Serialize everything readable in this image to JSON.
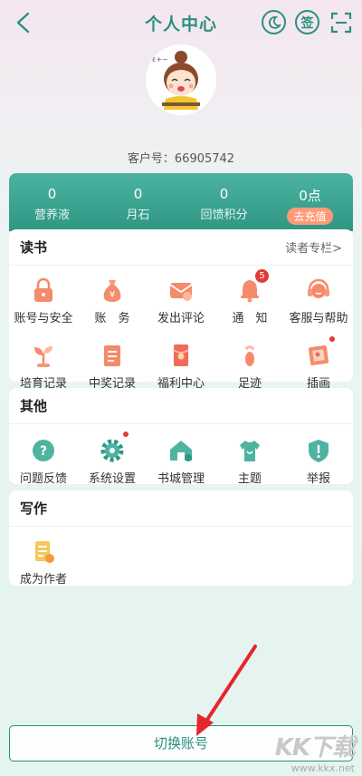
{
  "header": {
    "title": "个人中心",
    "sign_label": "签",
    "icons": [
      "back-icon",
      "moon-icon",
      "scan-icon"
    ]
  },
  "customer": {
    "label": "客户号：66905742"
  },
  "stats": [
    {
      "value": "0",
      "label": "营养液"
    },
    {
      "value": "0",
      "label": "月石"
    },
    {
      "value": "0",
      "label": "回馈积分"
    },
    {
      "value": "0点",
      "label": "去充值"
    }
  ],
  "reading": {
    "title": "读书",
    "link": "读者专栏>",
    "items": [
      {
        "label": "账号与安全",
        "icon": "lock-icon"
      },
      {
        "label": "账　务",
        "icon": "money-bag-icon"
      },
      {
        "label": "发出评论",
        "icon": "comment-mail-icon"
      },
      {
        "label": "通　知",
        "icon": "bell-icon",
        "badge": "5"
      },
      {
        "label": "客服与帮助",
        "icon": "customer-service-icon"
      },
      {
        "label": "培育记录",
        "icon": "sprout-icon"
      },
      {
        "label": "中奖记录",
        "icon": "prize-record-icon"
      },
      {
        "label": "福利中心",
        "icon": "red-envelope-icon"
      },
      {
        "label": "足迹",
        "icon": "footprint-icon"
      },
      {
        "label": "插画",
        "icon": "illustration-icon"
      }
    ]
  },
  "other": {
    "title": "其他",
    "items": [
      {
        "label": "问题反馈",
        "icon": "question-icon"
      },
      {
        "label": "系统设置",
        "icon": "settings-gear-icon"
      },
      {
        "label": "书城管理",
        "icon": "bookstore-icon"
      },
      {
        "label": "主题",
        "icon": "theme-shirt-icon"
      },
      {
        "label": "举报",
        "icon": "report-shield-icon"
      }
    ]
  },
  "writing": {
    "title": "写作",
    "items": [
      {
        "label": "成为作者",
        "icon": "become-author-icon"
      }
    ]
  },
  "footer": {
    "switch_label": "切换账号"
  },
  "watermark": {
    "big": "KK下载",
    "small": "www.kkx.net"
  },
  "colors": {
    "accent": "#2a8f82",
    "badge": "#e53935",
    "recharge": "#ff9a76",
    "arrow": "#e5262a"
  }
}
